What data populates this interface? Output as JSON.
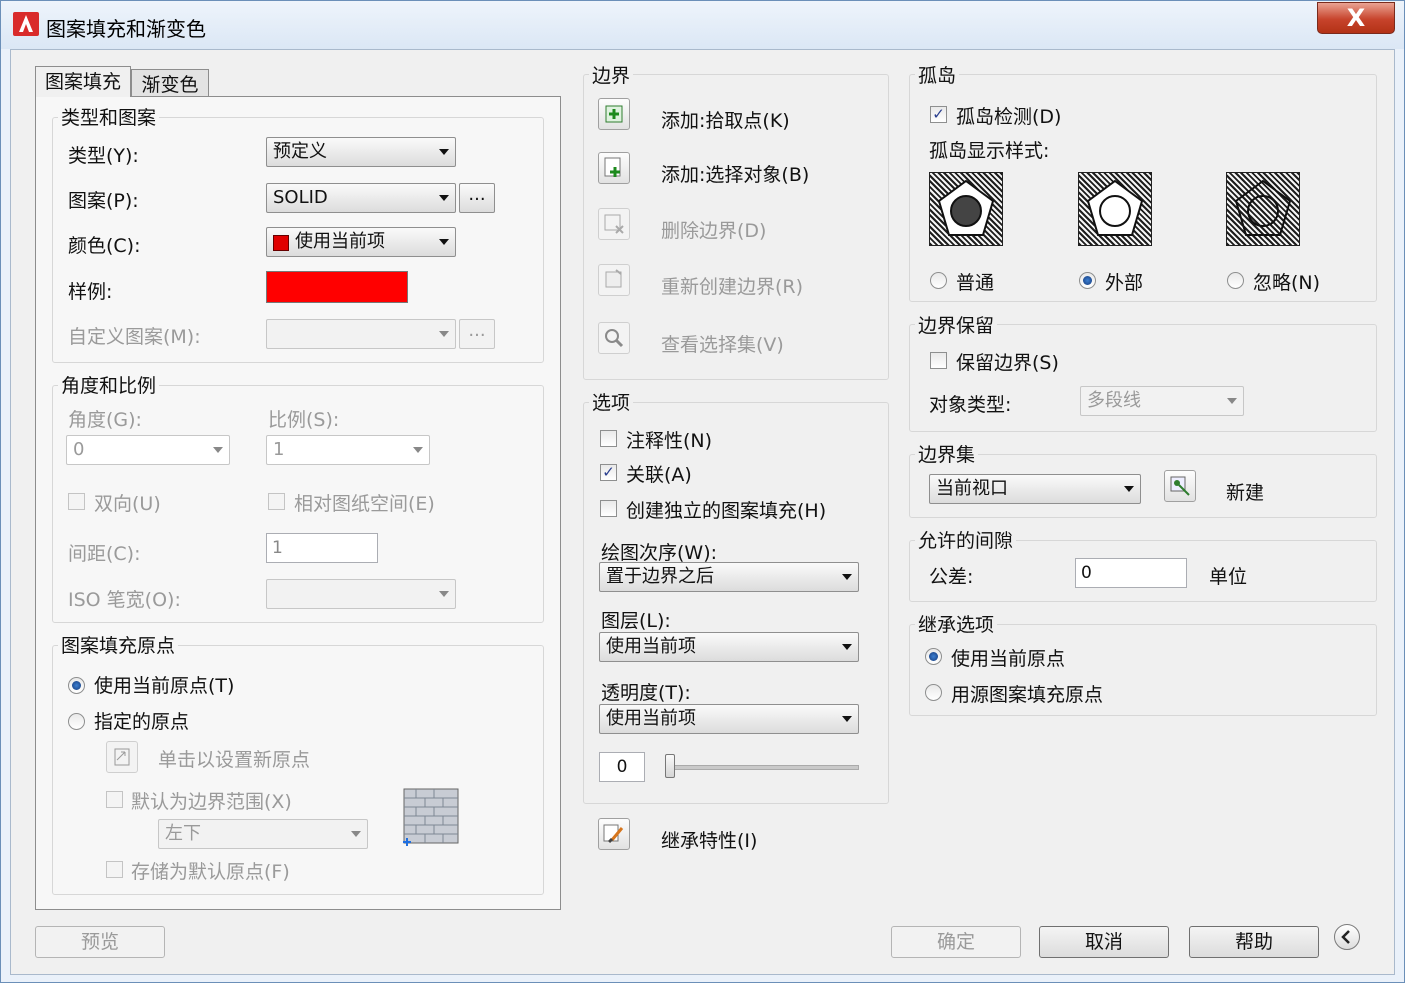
{
  "window": {
    "title": "图案填充和渐变色",
    "close_symbol": "X",
    "app_icon": "autocad-a-icon"
  },
  "tabs": [
    {
      "label": "图案填充",
      "active": true
    },
    {
      "label": "渐变色",
      "active": false
    }
  ],
  "type_pattern": {
    "title": "类型和图案",
    "type_label": "类型(Y):",
    "type_value": "预定义",
    "pattern_label": "图案(P):",
    "pattern_value": "SOLID",
    "ellipsis": "...",
    "color_label": "颜色(C):",
    "color_value": "使用当前项",
    "color_swatch": "#e00000",
    "swatch_label": "样例:",
    "swatch_color": "#ff0000",
    "custom_label": "自定义图案(M):",
    "custom_value": ""
  },
  "angle_scale": {
    "title": "角度和比例",
    "angle_label": "角度(G):",
    "angle_value": "0",
    "scale_label": "比例(S):",
    "scale_value": "1",
    "double_label": "双向(U)",
    "relative_label": "相对图纸空间(E)",
    "spacing_label": "间距(C):",
    "spacing_value": "1",
    "iso_label": "ISO 笔宽(O):",
    "iso_value": ""
  },
  "origin": {
    "title": "图案填充原点",
    "use_current": "使用当前原点(T)",
    "specified": "指定的原点",
    "click_set": "单击以设置新原点",
    "default_extents": "默认为边界范围(X)",
    "position_value": "左下",
    "store_default": "存储为默认原点(F)"
  },
  "boundary": {
    "title": "边界",
    "add_pick": "添加:拾取点(K)",
    "add_select": "添加:选择对象(B)",
    "remove": "删除边界(D)",
    "recreate": "重新创建边界(R)",
    "view_selection": "查看选择集(V)"
  },
  "options": {
    "title": "选项",
    "annotative": "注释性(N)",
    "associative": "关联(A)",
    "create_separate": "创建独立的图案填充(H)",
    "draw_order_label": "绘图次序(W):",
    "draw_order_value": "置于边界之后",
    "layer_label": "图层(L):",
    "layer_value": "使用当前项",
    "transparency_label": "透明度(T):",
    "transparency_value": "使用当前项",
    "transparency_amount": "0",
    "slider_fraction": 0
  },
  "inherit_button": "继承特性(I)",
  "islands": {
    "title": "孤岛",
    "detection": "孤岛检测(D)",
    "style_label": "孤岛显示样式:",
    "normal": "普通",
    "outer": "外部",
    "ignore": "忽略(N)",
    "selected": "outer"
  },
  "retain": {
    "title": "边界保留",
    "retain_label": "保留边界(S)",
    "object_type_label": "对象类型:",
    "object_type_value": "多段线"
  },
  "boundary_set": {
    "title": "边界集",
    "value": "当前视口",
    "new_label": "新建"
  },
  "gap": {
    "title": "允许的间隙",
    "tolerance_label": "公差:",
    "tolerance_value": "0",
    "units": "单位"
  },
  "inherit_options": {
    "title": "继承选项",
    "use_current": "使用当前原点",
    "use_source": "用源图案填充原点"
  },
  "footer": {
    "preview": "预览",
    "ok": "确定",
    "cancel": "取消",
    "help": "帮助",
    "collapse_icon": "collapse-left-icon"
  },
  "colors": {
    "title_bar": "#dbe7f5",
    "close": "#c7432b",
    "dialog_bg": "#f0f0f0",
    "accent": "#2a4f9f"
  }
}
